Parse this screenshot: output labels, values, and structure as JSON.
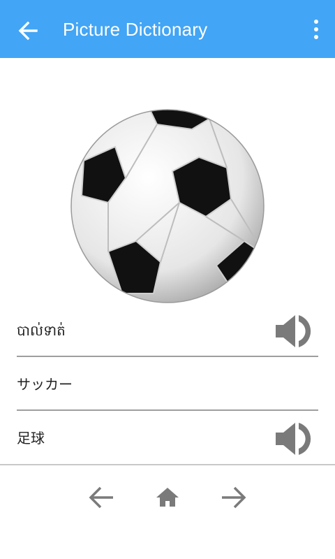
{
  "app_bar": {
    "title": "Picture Dictionary",
    "back_icon": "arrow-back-icon",
    "menu_icon": "more-vert-icon",
    "color": "#42a5f5"
  },
  "image": {
    "subject_icon": "soccer-ball"
  },
  "words": [
    {
      "text": "បាល់ទាត់",
      "has_audio": true
    },
    {
      "text": "サッカー",
      "has_audio": false
    },
    {
      "text": "足球",
      "has_audio": true
    }
  ],
  "bottom_nav": {
    "previous_icon": "arrow-left-icon",
    "home_icon": "home-icon",
    "next_icon": "arrow-right-icon",
    "icon_color": "#7a7a7a"
  }
}
